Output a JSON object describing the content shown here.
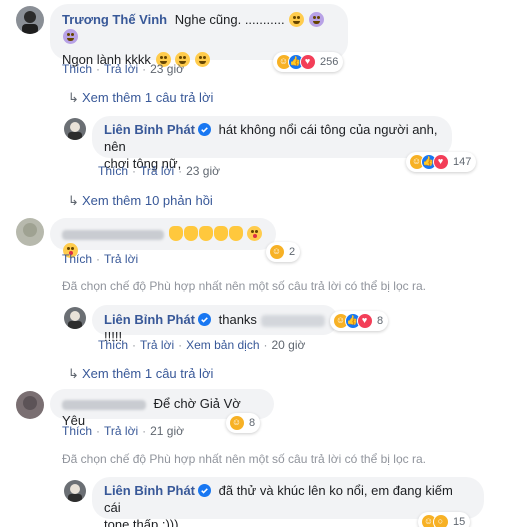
{
  "comment1": {
    "author": "Trương Thế Vinh",
    "text_line1": "Nghe cũng. ...........",
    "text_line2": "Ngon lành kkkk",
    "actions": {
      "like": "Thích",
      "reply": "Trả lời",
      "time": "23 giờ"
    },
    "reaction_count": "256",
    "reactions": [
      "haha",
      "like",
      "love"
    ]
  },
  "view_more_1": "Xem thêm 1 câu trả lời",
  "reply1": {
    "author": "Liên Bỉnh Phát",
    "text_line1": "hát không nổi cái tông của người anh, nên",
    "text_line2": "chơi tông nữ,",
    "actions": {
      "like": "Thích",
      "reply": "Trả lời",
      "time": "23 giờ"
    },
    "reaction_count": "147",
    "reactions": [
      "haha",
      "like",
      "love"
    ]
  },
  "view_more_replies": "Xem thêm 10 phản hồi",
  "comment2": {
    "actions": {
      "like": "Thích",
      "reply": "Trả lời"
    },
    "reaction_count": "2",
    "reactions": [
      "haha"
    ]
  },
  "filter_notice_1": "Đã chọn chế độ Phù hợp nhất nên một số câu trả lời có thể bị lọc ra.",
  "reply2": {
    "author": "Liên Bỉnh Phát",
    "text": "thanks",
    "text_suffix": "!!!!!",
    "actions": {
      "like": "Thích",
      "reply": "Trả lời",
      "translate": "Xem bản dịch",
      "time": "20 giờ"
    },
    "reaction_count": "8",
    "reactions": [
      "haha",
      "like",
      "love"
    ]
  },
  "view_more_2": "Xem thêm 1 câu trả lời",
  "comment3": {
    "text": "Để chờ Giả Vờ Yêu",
    "actions": {
      "like": "Thích",
      "reply": "Trả lời",
      "time": "21 giờ"
    },
    "reaction_count": "8",
    "reactions": [
      "haha"
    ]
  },
  "filter_notice_2": "Đã chọn chế độ Phù hợp nhất nên một số câu trả lời có thể bị lọc ra.",
  "reply3": {
    "author": "Liên Bỉnh Phát",
    "text_line1": "đã thử và khúc lên ko nổi, em đang kiếm cái",
    "text_line2": "tone thấp :)))",
    "reaction_count": "15",
    "reactions": [
      "haha",
      "wow"
    ]
  },
  "colors": {
    "link": "#385898",
    "bubble": "#f2f3f5",
    "meta": "#606770",
    "verified": "#1877f2"
  }
}
